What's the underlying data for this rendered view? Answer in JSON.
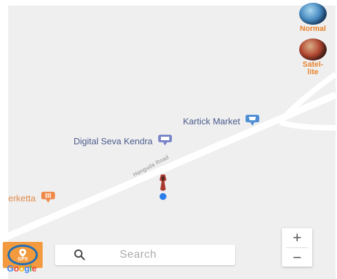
{
  "map_type_controls": {
    "normal_label": "Normal",
    "satellite_label": "Satel-\nlite"
  },
  "map": {
    "road_label": "Hanguda Road",
    "places": [
      {
        "name": "Kartick Market",
        "icon": "store-pin-icon",
        "color": "#4f8fd6"
      },
      {
        "name": "Digital Seva Kendra",
        "icon": "atm-pin-icon",
        "color": "#7a86c9"
      },
      {
        "name": "erketta",
        "icon": "restaurant-pin-icon",
        "color": "#f08a4b"
      }
    ]
  },
  "gps_button": {
    "label": "GPS"
  },
  "google_logo": "Google",
  "search": {
    "placeholder": "Search"
  },
  "zoom": {
    "in_label": "+",
    "out_label": "−"
  },
  "colors": {
    "map_background": "#efefef",
    "road": "#ffffff",
    "gps_button": "#f29a3d",
    "accent_orange": "#e8812b"
  }
}
